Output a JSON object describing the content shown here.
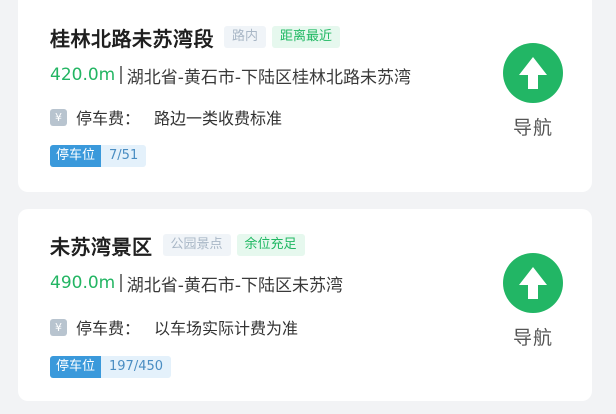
{
  "results": [
    {
      "name": "桂林北路未苏湾段",
      "type_tag": "路内",
      "highlight_tag": "距离最近",
      "distance": "420.0m",
      "address": "湖北省-黄石市-下陆区桂林北路未苏湾",
      "fee_icon": "¥",
      "fee_label": "停车费：",
      "fee_value": "路边一类收费标准",
      "parking_label": "停车位",
      "parking_count": "7/51",
      "nav_label": "导航"
    },
    {
      "name": "未苏湾景区",
      "type_tag": "公园景点",
      "highlight_tag": "余位充足",
      "distance": "490.0m",
      "address": "湖北省-黄石市-下陆区未苏湾",
      "fee_icon": "¥",
      "fee_label": "停车费：",
      "fee_value": "以车场实际计费为准",
      "parking_label": "停车位",
      "parking_count": "197/450",
      "nav_label": "导航"
    }
  ],
  "colors": {
    "accent_green": "#22b665",
    "parking_blue": "#3a99db",
    "background": "#f2f3f5"
  },
  "icons": {
    "nav": "navigate-arrow-icon",
    "fee": "yuan-icon"
  }
}
